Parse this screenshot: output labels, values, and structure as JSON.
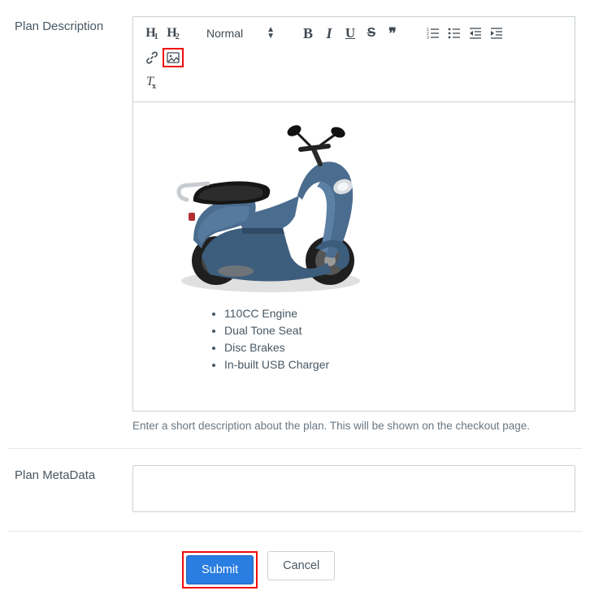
{
  "labels": {
    "plan_description": "Plan Description",
    "plan_metadata": "Plan MetaData"
  },
  "toolbar": {
    "format_label": "Normal",
    "h1": "H",
    "h1_sub": "1",
    "h2": "H",
    "h2_sub": "2",
    "bold": "B",
    "italic": "I",
    "underline": "U",
    "strike": "S",
    "quote": "❞",
    "clear_t": "T",
    "clear_x": "x"
  },
  "editor": {
    "bullets": [
      "110CC Engine",
      "Dual Tone Seat",
      "Disc Brakes",
      "In-built USB Charger"
    ],
    "help": "Enter a short description about the plan. This will be shown on the checkout page."
  },
  "metadata": {
    "value": ""
  },
  "buttons": {
    "submit": "Submit",
    "cancel": "Cancel"
  }
}
